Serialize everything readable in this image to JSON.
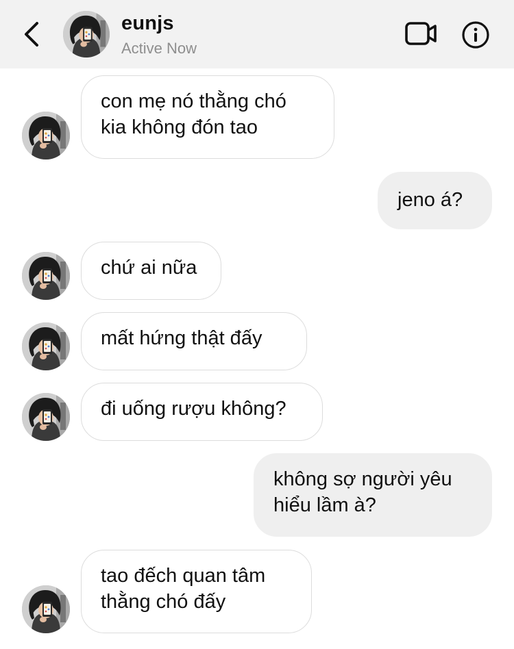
{
  "header": {
    "name": "eunjs",
    "status": "Active Now"
  },
  "icons": {
    "back": "chevron-left-icon",
    "video": "video-camera-icon",
    "info": "info-icon"
  },
  "colors": {
    "header_bg": "#f2f2f2",
    "incoming_bubble_bg": "#ffffff",
    "incoming_bubble_border": "#dcdcdc",
    "outgoing_bubble_bg": "#efefef",
    "status_text": "#8e8e8e"
  },
  "messages": [
    {
      "sender": "them",
      "text": "con mẹ nó thằng chó\nkia không đón tao"
    },
    {
      "sender": "me",
      "text": "jeno á?"
    },
    {
      "sender": "them",
      "text": "chứ ai nữa"
    },
    {
      "sender": "them",
      "text": "mất hứng thật đấy"
    },
    {
      "sender": "them",
      "text": "đi uống rượu không?"
    },
    {
      "sender": "me",
      "text": "không sợ người yêu\nhiểu lầm à?"
    },
    {
      "sender": "them",
      "text": "tao đếch quan tâm\nthằng chó đấy"
    }
  ]
}
